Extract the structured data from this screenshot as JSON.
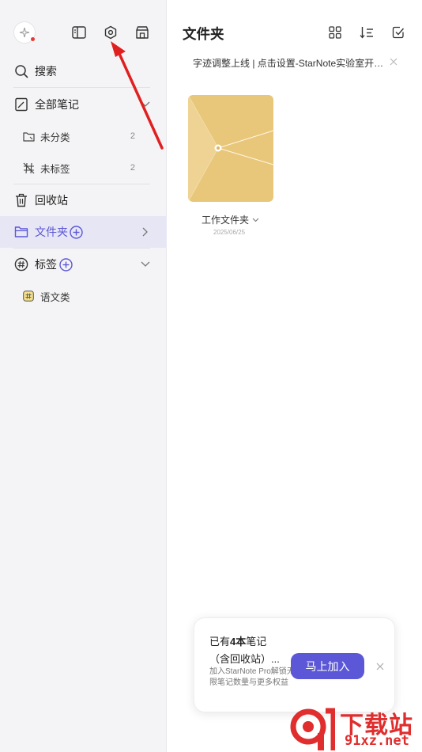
{
  "sidebar": {
    "search": "搜索",
    "all_notes": "全部笔记",
    "uncategorized": {
      "label": "未分类",
      "count": "2"
    },
    "untagged": {
      "label": "未标签",
      "count": "2"
    },
    "trash": "回收站",
    "folders": "文件夹",
    "tags": "标签",
    "tag_items": [
      "语文类"
    ]
  },
  "main": {
    "title": "文件夹",
    "notice": "字迹调整上线 | 点击设置-StarNote实验室开…",
    "folder": {
      "name": "工作文件夹",
      "date": "2025/06/25"
    }
  },
  "promo": {
    "line1_prefix": "已有",
    "line1_bold": "4本",
    "line1_suffix": "笔记",
    "line2": "（含回收站）...",
    "desc": "加入StarNote Pro解锁无限笔记数量与更多权益",
    "button": "马上加入"
  },
  "watermark": {
    "brand": "下载站",
    "domain": "91xz.net"
  },
  "colors": {
    "accent": "#5b57d6",
    "folder": "#e8c77a",
    "arrow": "#e02020"
  },
  "icons": {
    "avatar": "sparkle-icon",
    "toolbar": [
      "sidebar-toggle-icon",
      "settings-icon",
      "store-icon"
    ],
    "main_toolbar": [
      "grid-view-icon",
      "sort-icon",
      "select-icon"
    ]
  }
}
